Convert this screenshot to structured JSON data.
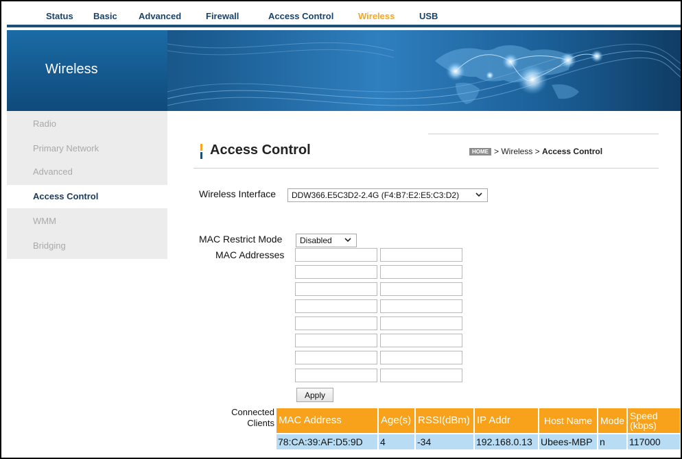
{
  "topnav": {
    "tabs": [
      {
        "label": "Status"
      },
      {
        "label": "Basic"
      },
      {
        "label": "Advanced"
      },
      {
        "label": "Firewall"
      },
      {
        "label": "Access Control"
      },
      {
        "label": "Wireless"
      },
      {
        "label": "USB"
      }
    ],
    "active_tab": "Wireless"
  },
  "banner": {
    "title": "Wireless"
  },
  "sidebar": {
    "items": [
      {
        "label": "Radio"
      },
      {
        "label": "Primary Network"
      },
      {
        "label": "Advanced"
      },
      {
        "label": "Access Control"
      },
      {
        "label": "WMM"
      },
      {
        "label": "Bridging"
      }
    ],
    "active_item": "Access Control"
  },
  "page": {
    "title": "Access Control",
    "breadcrumb": {
      "home_badge": "HOME",
      "path": "> Wireless > ",
      "current": "Access Control"
    }
  },
  "form": {
    "wireless_interface_label": "Wireless Interface",
    "wireless_interface_value": "DDW366.E5C3D2-2.4G (F4:B7:E2:E5:C3:D2)",
    "mac_restrict_mode_label": "MAC Restrict Mode",
    "mac_restrict_mode_value": "Disabled",
    "mac_addresses_label": "MAC Addresses",
    "mac_addresses": [
      "",
      "",
      "",
      "",
      "",
      "",
      "",
      "",
      "",
      "",
      "",
      "",
      "",
      "",
      "",
      ""
    ],
    "apply_label": "Apply"
  },
  "clients": {
    "label_line1": "Connected",
    "label_line2": "Clients",
    "columns": [
      "MAC Address",
      "Age(s)",
      "RSSI(dBm)",
      "IP Addr",
      "Host Name",
      "Mode",
      "Speed (kbps)"
    ],
    "rows": [
      [
        "78:CA:39:AF:D5:9D",
        "4",
        "-34",
        "192.168.0.13",
        "Ubees-MBP",
        "n",
        "117000"
      ]
    ]
  },
  "colors": {
    "nav_text": "#17436a",
    "nav_active": "#f5a623",
    "table_header": "#f7a21a",
    "table_row": "#b8dcf4",
    "banner_blue": "#1b5d92"
  },
  "icons": {
    "select_chevron": "chevron-down-icon",
    "home_badge": "home-badge-icon",
    "banner_art": "world-map-network-graphic"
  }
}
